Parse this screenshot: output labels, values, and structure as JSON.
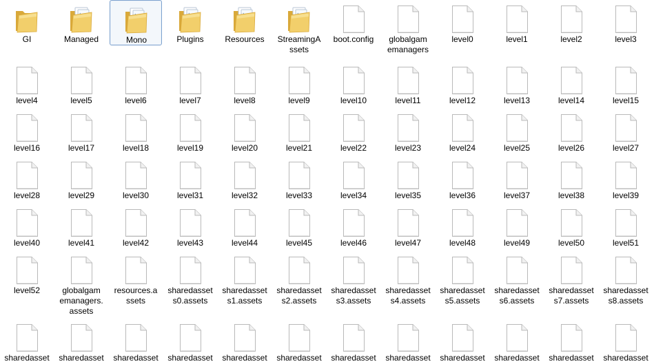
{
  "window": {
    "view": "large-icons",
    "selected_item": "Mono"
  },
  "colors": {
    "folder_main": "#f2cf6b",
    "folder_dark": "#d9a93a",
    "folder_light": "#f8e29a",
    "file_border": "#b9b9b9",
    "selection_border": "#7da2ce",
    "selection_fill": "#f3f7fb"
  },
  "items": [
    {
      "name": "GI",
      "type": "folder",
      "icon": "folder-icon"
    },
    {
      "name": "Managed",
      "type": "folder",
      "icon": "folder-with-files-icon"
    },
    {
      "name": "Mono",
      "type": "folder",
      "icon": "folder-with-files-icon",
      "selected": true
    },
    {
      "name": "Plugins",
      "type": "folder",
      "icon": "folder-with-files-icon"
    },
    {
      "name": "Resources",
      "type": "folder",
      "icon": "folder-with-files-icon"
    },
    {
      "name": "StreamingAssets",
      "label": "StreamingA\nssets",
      "type": "folder",
      "icon": "folder-with-files-icon"
    },
    {
      "name": "boot.config",
      "type": "file",
      "icon": "file-icon"
    },
    {
      "name": "globalgamemanagers",
      "label": "globalgam\nemanagers",
      "type": "file",
      "icon": "file-icon"
    },
    {
      "name": "level0",
      "type": "file",
      "icon": "file-icon"
    },
    {
      "name": "level1",
      "type": "file",
      "icon": "file-icon"
    },
    {
      "name": "level2",
      "type": "file",
      "icon": "file-icon"
    },
    {
      "name": "level3",
      "type": "file",
      "icon": "file-icon"
    },
    {
      "name": "level4",
      "type": "file",
      "icon": "file-icon"
    },
    {
      "name": "level5",
      "type": "file",
      "icon": "file-icon"
    },
    {
      "name": "level6",
      "type": "file",
      "icon": "file-icon"
    },
    {
      "name": "level7",
      "type": "file",
      "icon": "file-icon"
    },
    {
      "name": "level8",
      "type": "file",
      "icon": "file-icon"
    },
    {
      "name": "level9",
      "type": "file",
      "icon": "file-icon"
    },
    {
      "name": "level10",
      "type": "file",
      "icon": "file-icon"
    },
    {
      "name": "level11",
      "type": "file",
      "icon": "file-icon"
    },
    {
      "name": "level12",
      "type": "file",
      "icon": "file-icon"
    },
    {
      "name": "level13",
      "type": "file",
      "icon": "file-icon"
    },
    {
      "name": "level14",
      "type": "file",
      "icon": "file-icon"
    },
    {
      "name": "level15",
      "type": "file",
      "icon": "file-icon"
    },
    {
      "name": "level16",
      "type": "file",
      "icon": "file-icon"
    },
    {
      "name": "level17",
      "type": "file",
      "icon": "file-icon"
    },
    {
      "name": "level18",
      "type": "file",
      "icon": "file-icon"
    },
    {
      "name": "level19",
      "type": "file",
      "icon": "file-icon"
    },
    {
      "name": "level20",
      "type": "file",
      "icon": "file-icon"
    },
    {
      "name": "level21",
      "type": "file",
      "icon": "file-icon"
    },
    {
      "name": "level22",
      "type": "file",
      "icon": "file-icon"
    },
    {
      "name": "level23",
      "type": "file",
      "icon": "file-icon"
    },
    {
      "name": "level24",
      "type": "file",
      "icon": "file-icon"
    },
    {
      "name": "level25",
      "type": "file",
      "icon": "file-icon"
    },
    {
      "name": "level26",
      "type": "file",
      "icon": "file-icon"
    },
    {
      "name": "level27",
      "type": "file",
      "icon": "file-icon"
    },
    {
      "name": "level28",
      "type": "file",
      "icon": "file-icon"
    },
    {
      "name": "level29",
      "type": "file",
      "icon": "file-icon"
    },
    {
      "name": "level30",
      "type": "file",
      "icon": "file-icon"
    },
    {
      "name": "level31",
      "type": "file",
      "icon": "file-icon"
    },
    {
      "name": "level32",
      "type": "file",
      "icon": "file-icon"
    },
    {
      "name": "level33",
      "type": "file",
      "icon": "file-icon"
    },
    {
      "name": "level34",
      "type": "file",
      "icon": "file-icon"
    },
    {
      "name": "level35",
      "type": "file",
      "icon": "file-icon"
    },
    {
      "name": "level36",
      "type": "file",
      "icon": "file-icon"
    },
    {
      "name": "level37",
      "type": "file",
      "icon": "file-icon"
    },
    {
      "name": "level38",
      "type": "file",
      "icon": "file-icon"
    },
    {
      "name": "level39",
      "type": "file",
      "icon": "file-icon"
    },
    {
      "name": "level40",
      "type": "file",
      "icon": "file-icon"
    },
    {
      "name": "level41",
      "type": "file",
      "icon": "file-icon"
    },
    {
      "name": "level42",
      "type": "file",
      "icon": "file-icon"
    },
    {
      "name": "level43",
      "type": "file",
      "icon": "file-icon"
    },
    {
      "name": "level44",
      "type": "file",
      "icon": "file-icon"
    },
    {
      "name": "level45",
      "type": "file",
      "icon": "file-icon"
    },
    {
      "name": "level46",
      "type": "file",
      "icon": "file-icon"
    },
    {
      "name": "level47",
      "type": "file",
      "icon": "file-icon"
    },
    {
      "name": "level48",
      "type": "file",
      "icon": "file-icon"
    },
    {
      "name": "level49",
      "type": "file",
      "icon": "file-icon"
    },
    {
      "name": "level50",
      "type": "file",
      "icon": "file-icon"
    },
    {
      "name": "level51",
      "type": "file",
      "icon": "file-icon"
    },
    {
      "name": "level52",
      "type": "file",
      "icon": "file-icon"
    },
    {
      "name": "globalgamemanagers.assets",
      "label": "globalgam\nemanagers.\nassets",
      "type": "file",
      "icon": "file-icon"
    },
    {
      "name": "resources.assets",
      "label": "resources.a\nssets",
      "type": "file",
      "icon": "file-icon"
    },
    {
      "name": "sharedassets0.assets",
      "label": "sharedasset\ns0.assets",
      "type": "file",
      "icon": "file-icon"
    },
    {
      "name": "sharedassets1.assets",
      "label": "sharedasset\ns1.assets",
      "type": "file",
      "icon": "file-icon"
    },
    {
      "name": "sharedassets2.assets",
      "label": "sharedasset\ns2.assets",
      "type": "file",
      "icon": "file-icon"
    },
    {
      "name": "sharedassets3.assets",
      "label": "sharedasset\ns3.assets",
      "type": "file",
      "icon": "file-icon"
    },
    {
      "name": "sharedassets4.assets",
      "label": "sharedasset\ns4.assets",
      "type": "file",
      "icon": "file-icon"
    },
    {
      "name": "sharedassets5.assets",
      "label": "sharedasset\ns5.assets",
      "type": "file",
      "icon": "file-icon"
    },
    {
      "name": "sharedassets6.assets",
      "label": "sharedasset\ns6.assets",
      "type": "file",
      "icon": "file-icon"
    },
    {
      "name": "sharedassets7.assets",
      "label": "sharedasset\ns7.assets",
      "type": "file",
      "icon": "file-icon"
    },
    {
      "name": "sharedassets8.assets",
      "label": "sharedasset\ns8.assets",
      "type": "file",
      "icon": "file-icon"
    },
    {
      "name": "sharedasset",
      "type": "file",
      "icon": "file-icon"
    },
    {
      "name": "sharedasset",
      "type": "file",
      "icon": "file-icon"
    },
    {
      "name": "sharedasset",
      "type": "file",
      "icon": "file-icon"
    },
    {
      "name": "sharedasset",
      "type": "file",
      "icon": "file-icon"
    },
    {
      "name": "sharedasset",
      "type": "file",
      "icon": "file-icon"
    },
    {
      "name": "sharedasset",
      "type": "file",
      "icon": "file-icon"
    },
    {
      "name": "sharedasset",
      "type": "file",
      "icon": "file-icon"
    },
    {
      "name": "sharedasset",
      "type": "file",
      "icon": "file-icon"
    },
    {
      "name": "sharedasset",
      "type": "file",
      "icon": "file-icon"
    },
    {
      "name": "sharedasset",
      "type": "file",
      "icon": "file-icon"
    },
    {
      "name": "sharedasset",
      "type": "file",
      "icon": "file-icon"
    },
    {
      "name": "sharedasset",
      "type": "file",
      "icon": "file-icon"
    }
  ]
}
